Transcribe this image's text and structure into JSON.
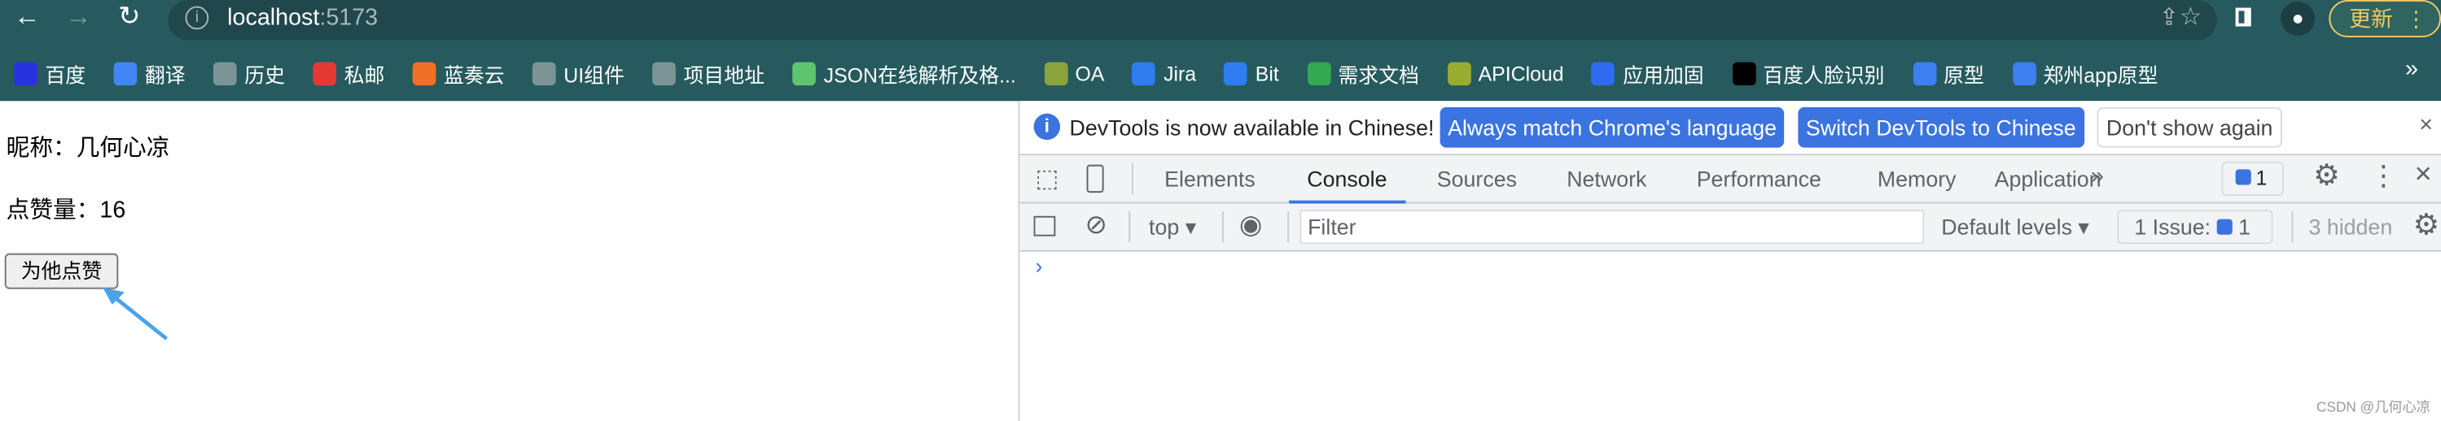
{
  "browser": {
    "url_host": "localhost",
    "url_port": ":5173",
    "update_label": "更新",
    "bookmarks": [
      {
        "label": "百度",
        "icon": "baidu-icon",
        "color": "#2932e1"
      },
      {
        "label": "翻译",
        "icon": "translate-icon",
        "color": "#4285f4"
      },
      {
        "label": "历史",
        "icon": "folder-icon",
        "color": "#7d9497"
      },
      {
        "label": "私邮",
        "icon": "mail-icon",
        "color": "#e53935"
      },
      {
        "label": "蓝奏云",
        "icon": "lanzou-icon",
        "color": "#f07027"
      },
      {
        "label": "UI组件",
        "icon": "folder-icon",
        "color": "#7d9497"
      },
      {
        "label": "项目地址",
        "icon": "folder-icon",
        "color": "#7d9497"
      },
      {
        "label": "JSON在线解析及格...",
        "icon": "json-icon",
        "color": "#5fc46e"
      },
      {
        "label": "OA",
        "icon": "oa-icon",
        "color": "#8aa33b"
      },
      {
        "label": "Jira",
        "icon": "jira-icon",
        "color": "#2f7bf0"
      },
      {
        "label": "Bit",
        "icon": "bitbucket-icon",
        "color": "#2f7bf0"
      },
      {
        "label": "需求文档",
        "icon": "sheet-icon",
        "color": "#34a853"
      },
      {
        "label": "APICloud",
        "icon": "apicloud-icon",
        "color": "#9aab32"
      },
      {
        "label": "应用加固",
        "icon": "shield-icon",
        "color": "#2f6bf0"
      },
      {
        "label": "百度人脸识别",
        "icon": "ai-icon",
        "color": "#000000"
      },
      {
        "label": "原型",
        "icon": "prototype-icon",
        "color": "#3d7ef0"
      },
      {
        "label": "郑州app原型",
        "icon": "prototype-icon",
        "color": "#3d7ef0"
      }
    ]
  },
  "page": {
    "nickname": "昵称：几何心凉",
    "likes": "点赞量：16",
    "like_button": "为他点赞",
    "watermark": "CSDN @几何心凉"
  },
  "devtools": {
    "info_text": "DevTools is now available in Chinese!",
    "btn_match": "Always match Chrome's language",
    "btn_switch": "Switch DevTools to Chinese",
    "btn_dont": "Don't show again",
    "tabs": [
      "Elements",
      "Console",
      "Sources",
      "Network",
      "Performance",
      "Memory",
      "Application"
    ],
    "active_tab": "Console",
    "issues_count": "1",
    "context": "top",
    "filter_placeholder": "Filter",
    "levels": "Default levels",
    "issue_label": "1 Issue:",
    "issue_count": "1",
    "hidden": "3 hidden",
    "prompt": "›",
    "accent": "#3b74e0"
  }
}
